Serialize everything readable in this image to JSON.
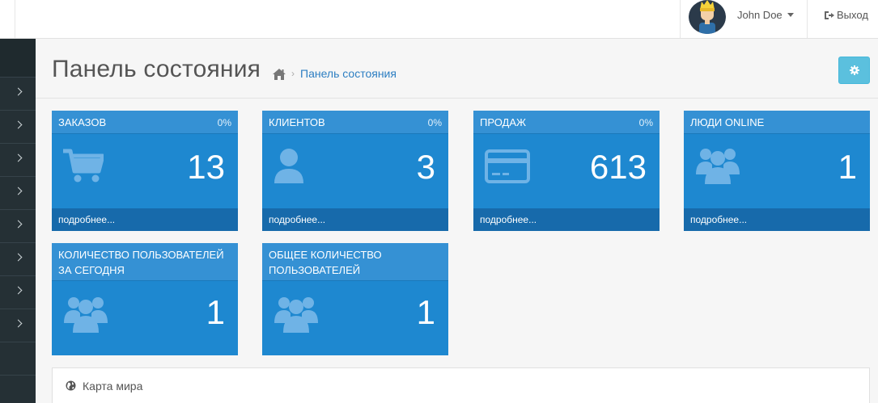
{
  "header": {
    "user_name": "John Doe",
    "logout_label": "Выход"
  },
  "page": {
    "title": "Панель состояния",
    "breadcrumb": "Панель состояния"
  },
  "tiles": [
    {
      "title": "ЗАКАЗОВ",
      "percent": "0%",
      "value": "13",
      "icon": "shopping-cart-icon",
      "footer": "подробнее..."
    },
    {
      "title": "КЛИЕНТОВ",
      "percent": "0%",
      "value": "3",
      "icon": "user-icon",
      "footer": "подробнее..."
    },
    {
      "title": "ПРОДАЖ",
      "percent": "0%",
      "value": "613",
      "icon": "credit-card-icon",
      "footer": "подробнее..."
    },
    {
      "title": "ЛЮДИ ONLINE",
      "value": "1",
      "icon": "users-icon",
      "footer": "подробнее..."
    },
    {
      "title_line1": "КОЛИЧЕСТВО ПОЛЬЗОВАТЕЛЕЙ",
      "title_line2": "ЗА СЕГОДНЯ",
      "value": "1",
      "icon": "users-icon"
    },
    {
      "title_line1": "ОБЩЕЕ КОЛИЧЕСТВО",
      "title_line2": "ПОЛЬЗОВАТЕЛЕЙ",
      "value": "1",
      "icon": "users-icon"
    }
  ],
  "map_panel": {
    "title": "Карта мира",
    "icon": "globe-icon"
  },
  "colors": {
    "tile_body": "#1e88d0",
    "tile_head": "#3591d4",
    "tile_foot": "#176aab",
    "sidebar": "#253035",
    "settings_button": "#5bc0de",
    "link": "#2c7ec2"
  }
}
